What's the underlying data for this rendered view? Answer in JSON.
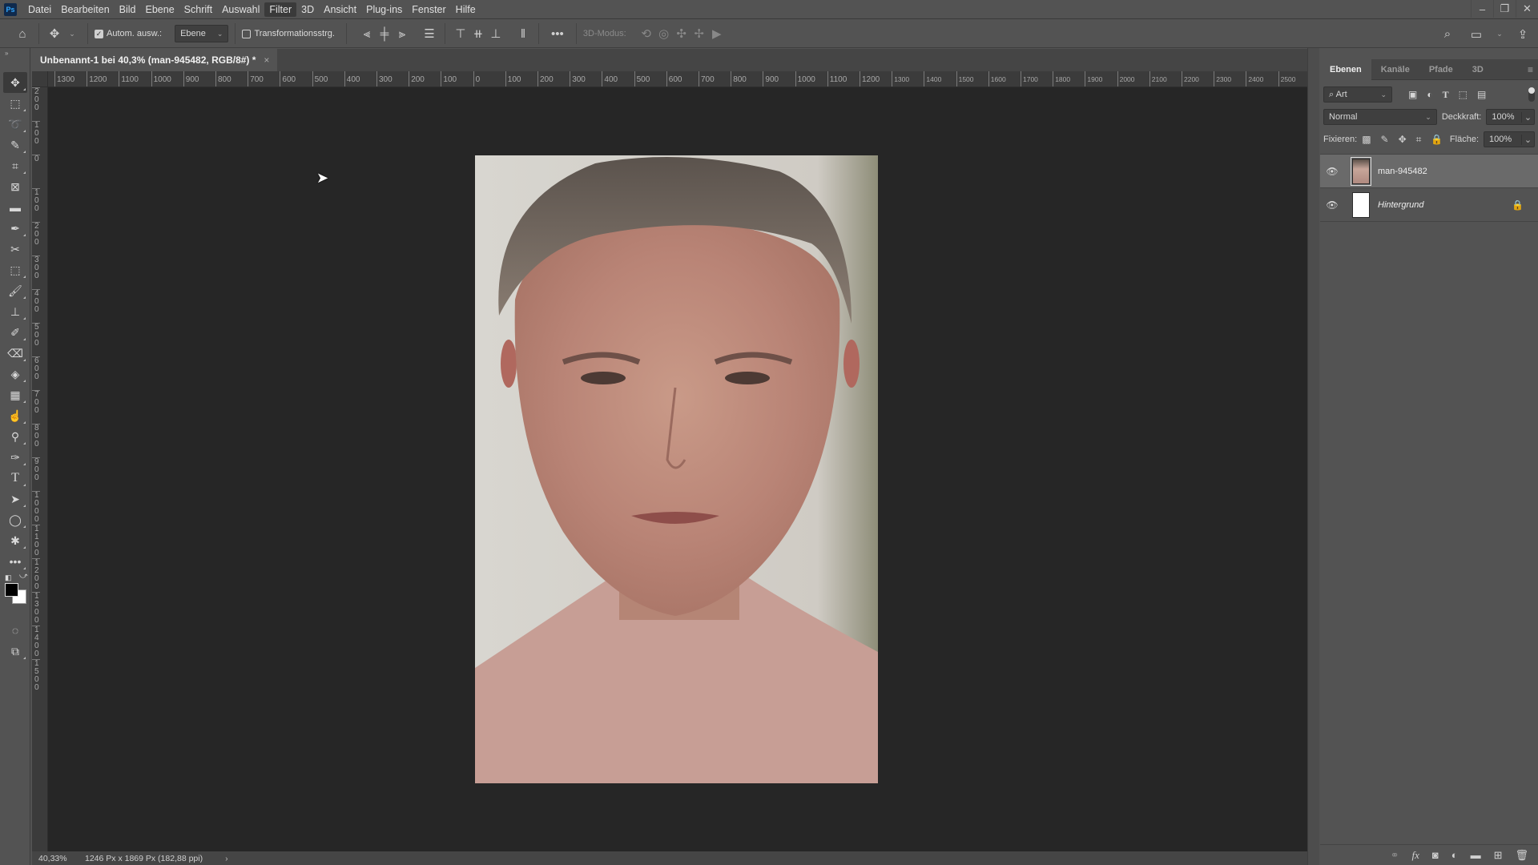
{
  "app": {
    "logo": "Ps"
  },
  "menu": [
    "Datei",
    "Bearbeiten",
    "Bild",
    "Ebene",
    "Schrift",
    "Auswahl",
    "Filter",
    "3D",
    "Ansicht",
    "Plug-ins",
    "Fenster",
    "Hilfe"
  ],
  "menu_active": "Filter",
  "window_controls": {
    "minimize": "–",
    "restore": "❐",
    "close": "✕"
  },
  "options": {
    "auto_select_label": "Autom. ausw.:",
    "auto_select_checked": true,
    "auto_select_target": "Ebene",
    "transform_controls_label": "Transformationsstrg.",
    "transform_controls_checked": false,
    "more": "•••",
    "mode_3d_label": "3D-Modus:"
  },
  "document": {
    "tab_title": "Unbenannt-1 bei 40,3% (man-945482, RGB/8#) *",
    "close": "×"
  },
  "rulers": {
    "horizontal": [
      "1300",
      "1200",
      "1100",
      "1000",
      "900",
      "800",
      "700",
      "600",
      "500",
      "400",
      "300",
      "200",
      "100",
      "0",
      "100",
      "200",
      "300",
      "400",
      "500",
      "600",
      "700",
      "800",
      "900",
      "1000",
      "1100",
      "1200",
      "1300",
      "1400",
      "1500",
      "1600",
      "1700",
      "1800",
      "1900",
      "2000",
      "2100",
      "2200",
      "2300",
      "2400",
      "2500"
    ],
    "vertical": [
      "200",
      "100",
      "0",
      "100",
      "200",
      "300",
      "400",
      "500",
      "600",
      "700",
      "800",
      "900",
      "1000",
      "1100",
      "1200",
      "1300",
      "1400",
      "1500"
    ]
  },
  "status": {
    "zoom": "40,33%",
    "info": "1246 Px x 1869 Px (182,88 ppi)",
    "arrow": "›"
  },
  "layers_panel": {
    "tabs": [
      "Ebenen",
      "Kanäle",
      "Pfade",
      "3D"
    ],
    "active_tab": "Ebenen",
    "filter_kind": "Art",
    "blend_mode": "Normal",
    "opacity_label": "Deckkraft:",
    "opacity": "100%",
    "lock_label": "Fixieren:",
    "fill_label": "Fläche:",
    "fill": "100%",
    "layers": [
      {
        "name": "man-945482",
        "visible": true,
        "selected": true,
        "smart_object": true
      },
      {
        "name": "Hintergrund",
        "visible": true,
        "selected": false,
        "locked": true
      }
    ]
  }
}
